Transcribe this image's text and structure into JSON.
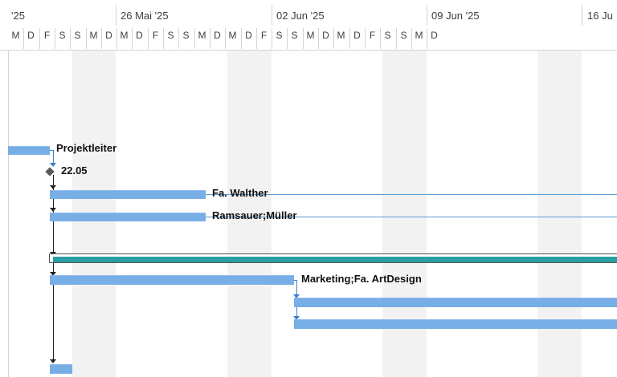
{
  "timescale": {
    "weeks": [
      "'25",
      "26 Mai '25",
      "02 Jun '25",
      "09 Jun '25",
      "16 Ju"
    ],
    "days": [
      "M",
      "D",
      "F",
      "S",
      "S",
      "M",
      "D",
      "M",
      "D",
      "F",
      "S",
      "S",
      "M",
      "D",
      "M",
      "D",
      "F",
      "S",
      "S",
      "M",
      "D",
      "M",
      "D",
      "F",
      "S",
      "S",
      "M",
      "D"
    ]
  },
  "gantt": {
    "labels": {
      "projektleiter": "Projektleiter",
      "milestone_date": "22.05",
      "fa_walther": "Fa. Walther",
      "ramsauer_mueller": "Ramsauer;Müller",
      "marketing": "Marketing;Fa. ArtDesign"
    }
  },
  "colors": {
    "task_bar": "#78aee6",
    "summary_bar": "#2a9ea2",
    "link_line": "#3a7fd1",
    "weekend": "#f2f2f2"
  }
}
